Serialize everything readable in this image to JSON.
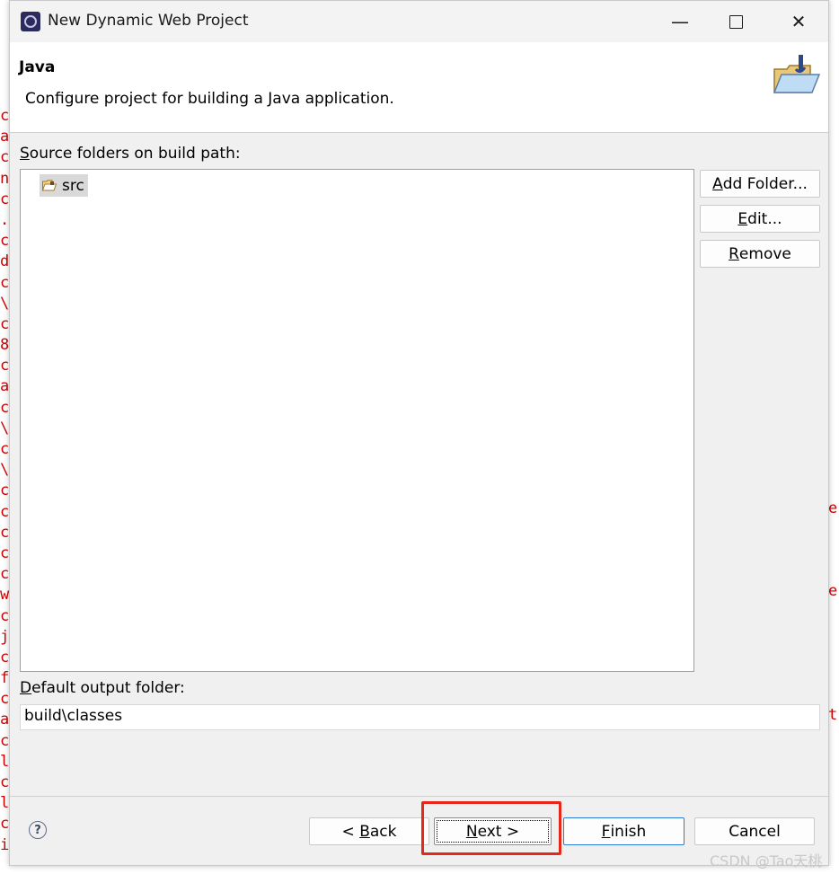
{
  "window": {
    "title": "New Dynamic Web Project",
    "minimize_glyph": "—",
    "maximize_glyph": "☐",
    "close_glyph": "✕"
  },
  "header": {
    "title": "Java",
    "description": "Configure project for building a Java application.",
    "icon": "java-folder-icon"
  },
  "source": {
    "label_mnemonic": "S",
    "label_rest": "ource folders on build path:",
    "items": [
      {
        "label": "src",
        "icon": "source-folder-icon"
      }
    ]
  },
  "side_buttons": {
    "add_folder_mnemonic": "A",
    "add_folder_rest": "dd Folder...",
    "edit_mnemonic": "E",
    "edit_rest": "dit...",
    "remove_mnemonic": "R",
    "remove_rest": "emove"
  },
  "output": {
    "label_mnemonic": "D",
    "label_rest": "efault output folder:",
    "value": "build\\classes"
  },
  "footer": {
    "help_glyph": "?",
    "back_prefix": "< ",
    "back_mnemonic": "B",
    "back_rest": "ack",
    "next_mnemonic": "N",
    "next_rest": "ext >",
    "finish_mnemonic": "F",
    "finish_rest": "inish",
    "cancel_label": "Cancel"
  },
  "watermark": "CSDN @Tao天桃",
  "colors": {
    "highlight": "#e8271b",
    "primary_border": "#2b7bd8",
    "background_code": "#d00000"
  },
  "background_editor": {
    "left_chars": [
      "c",
      "a",
      "c",
      "n",
      "c",
      ".",
      "c",
      "d",
      "c",
      "\\",
      "c",
      "8",
      "c",
      "a",
      "c",
      "\\",
      "c",
      "\\",
      "c",
      "c",
      "c",
      "c",
      "c",
      "w",
      "c",
      "j",
      "c",
      "f",
      "c",
      "a",
      "c",
      "l",
      "c",
      "l",
      "c",
      "i"
    ],
    "right_chars": [
      "e",
      "e",
      "t"
    ]
  }
}
